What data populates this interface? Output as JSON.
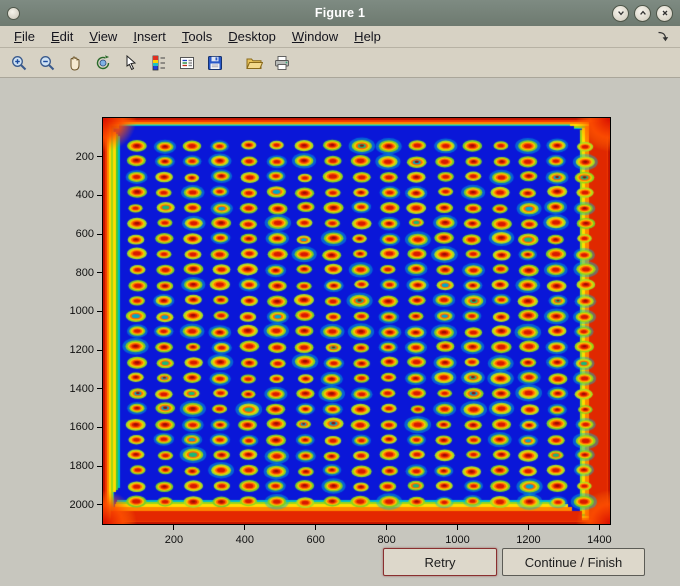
{
  "window": {
    "title": "Figure 1"
  },
  "menu_bar": {
    "items": [
      {
        "label": "File"
      },
      {
        "label": "Edit"
      },
      {
        "label": "View"
      },
      {
        "label": "Insert"
      },
      {
        "label": "Tools"
      },
      {
        "label": "Desktop"
      },
      {
        "label": "Window"
      },
      {
        "label": "Help"
      }
    ]
  },
  "toolbar": {
    "buttons": [
      {
        "name": "zoom-in"
      },
      {
        "name": "zoom-out"
      },
      {
        "name": "pan"
      },
      {
        "name": "rotate-3d"
      },
      {
        "name": "data-cursor"
      },
      {
        "name": "insert-colorbar"
      },
      {
        "name": "insert-legend"
      },
      {
        "name": "save-figure"
      },
      {
        "name": "open-file"
      },
      {
        "name": "print-figure"
      }
    ]
  },
  "action_buttons": {
    "retry": "Retry",
    "continue_finish": "Continue / Finish"
  },
  "theme": {
    "titlebar": "#6e7a70",
    "chrome": "#d7d2c4",
    "figure_bg": "#c7c6be",
    "button_bg": "#ddd8cb",
    "accent_border": "#8a2f2f"
  },
  "chart_data": {
    "type": "heatmap",
    "title": "",
    "xlabel": "",
    "ylabel": "",
    "colormap": "jet",
    "x_range": [
      0,
      1430
    ],
    "y_range": [
      0,
      2100
    ],
    "y_axis_direction": "reverse",
    "x_ticks": [
      200,
      400,
      600,
      800,
      1000,
      1200,
      1400
    ],
    "y_ticks": [
      200,
      400,
      600,
      800,
      1000,
      1200,
      1400,
      1600,
      1800,
      2000
    ],
    "grid_on": false,
    "legend": "none",
    "description": "Scanned plate/microarray image in jet colormap: deep blue field with a 17 x 24 grid of hot spots (red-orange cores, yellow ring, green-yellow rim), saturated red/orange bands along all four image edges (widest on the right), bright red corners.",
    "grid": {
      "cols": 17,
      "rows": 24,
      "x_start": 95,
      "y_start": 145,
      "x_spacing": 79,
      "y_spacing": 80
    },
    "colors": {
      "background_blue": "#0a17d8",
      "edge_ramp": [
        "#c01400",
        "#f23800",
        "#ff8800",
        "#ffdc00",
        "#9ad818",
        "#00bcc8"
      ],
      "edge_right_red": "#e02800",
      "edge_bottom_red": "#e42800",
      "edge_left_green": "#44c838",
      "corner_hot": "#dc1400",
      "spot_rim": [
        "#8fd818",
        "#a6e020",
        "#78d024"
      ],
      "spot_ring": "#ffc400",
      "spot_hot": "#ff6400",
      "spot_core": "#d81800",
      "spot_core_dark": "#9c0c00",
      "spot_anomaly_green": "#18b878",
      "spot_anomaly_cyan": "#00a8c8",
      "spot_halo": "rgba(0,190,210,0.45)"
    },
    "seed": 42
  }
}
